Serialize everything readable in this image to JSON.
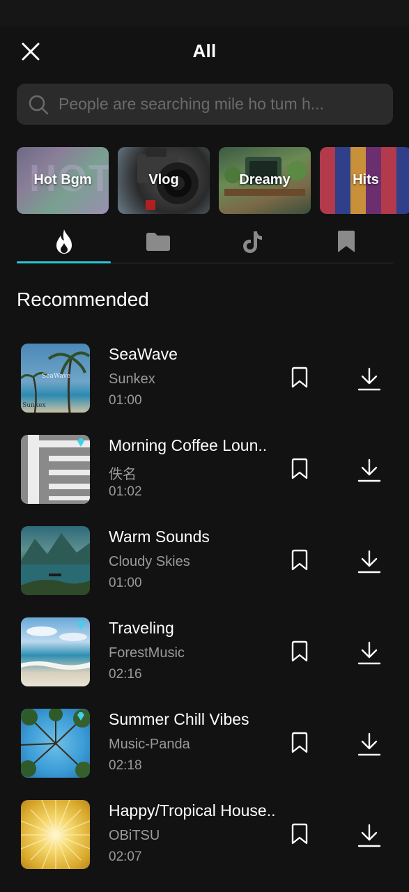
{
  "header": {
    "title": "All",
    "close_icon": "close-icon"
  },
  "search": {
    "placeholder": "People are searching mile ho tum h...",
    "icon": "search-icon"
  },
  "categories": [
    {
      "label": "Hot Bgm",
      "bg_text": "HOT"
    },
    {
      "label": "Vlog"
    },
    {
      "label": "Dreamy"
    },
    {
      "label": "Hits"
    }
  ],
  "tabs": [
    {
      "icon": "flame-icon",
      "selected": true
    },
    {
      "icon": "folder-icon",
      "selected": false
    },
    {
      "icon": "tiktok-icon",
      "selected": false
    },
    {
      "icon": "bookmark-icon",
      "selected": false
    }
  ],
  "section": {
    "title": "Recommended"
  },
  "tracks": [
    {
      "name": "SeaWave",
      "artist": "Sunkex",
      "duration": "01:00",
      "thumb_text_top": "SeaWave",
      "thumb_text_bottom": "Sunkex",
      "premium": false
    },
    {
      "name": "Morning Coffee Loun..",
      "artist": "佚名",
      "duration": "01:02",
      "premium": true
    },
    {
      "name": "Warm Sounds",
      "artist": "Cloudy Skies",
      "duration": "01:00",
      "premium": false
    },
    {
      "name": "Traveling",
      "artist": "ForestMusic",
      "duration": "02:16",
      "premium": true
    },
    {
      "name": "Summer Chill Vibes",
      "artist": "Music-Panda",
      "duration": "02:18",
      "premium": true
    },
    {
      "name": "Happy/Tropical House..",
      "artist": "OBiTSU",
      "duration": "02:07",
      "premium": false
    }
  ],
  "colors": {
    "background": "#121212",
    "accent": "#2fc3d5",
    "search_bg": "#2b2b2b",
    "secondary_text": "#9a9a9a",
    "premium_badge": "#3fd3e8"
  }
}
